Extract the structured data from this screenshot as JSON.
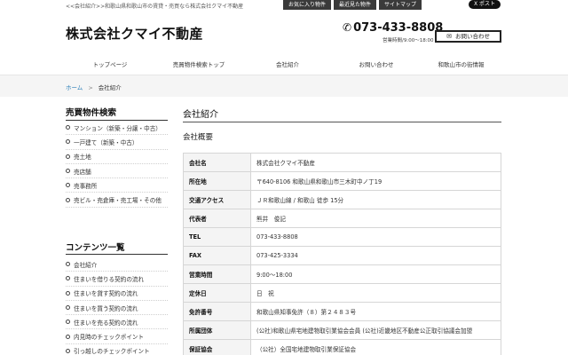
{
  "top": {
    "breadcrumb": "<<会社紹介>>和歌山県和歌山市の賃貸・売買なら株式会社クマイ不動産",
    "tabs": [
      "お気に入り物件",
      "最近見た物件",
      "サイトマップ"
    ],
    "post": "X ポスト"
  },
  "header": {
    "title": "株式会社クマイ不動産",
    "phone": "073-433-8808",
    "hours": "営業時間/9:00～18:00",
    "contact": "お問い合わせ"
  },
  "nav": [
    "トップページ",
    "売買物件検索トップ",
    "会社紹介",
    "お問い合わせ",
    "和歌山市の街情報"
  ],
  "crumb": {
    "home": "ホーム",
    "sep": ">",
    "current": "会社紹介"
  },
  "sidebar": {
    "search_title": "売買物件検索",
    "search_items": [
      "マンション（新築・分譲・中古）",
      "一戸建て（新築・中古）",
      "売土地",
      "売店舗",
      "売事務所",
      "売ビル・売倉庫・売工場・その他"
    ],
    "content_title": "コンテンツ一覧",
    "content_items": [
      "会社紹介",
      "住まいを借りる契約の流れ",
      "住まいを貸す契約の流れ",
      "住まいを買う契約の流れ",
      "住まいを売る契約の流れ",
      "内見時のチェックポイント",
      "引っ越しのチェックポイント"
    ]
  },
  "main": {
    "title": "会社紹介",
    "subtitle": "会社概要",
    "rows": [
      {
        "label": "会社名",
        "value": "株式会社クマイ不動産"
      },
      {
        "label": "所在地",
        "value": "〒640-8106 和歌山県和歌山市三木町中ノ丁19"
      },
      {
        "label": "交通アクセス",
        "value": "ＪＲ和歌山線 / 和歌山 徒歩 15分"
      },
      {
        "label": "代表者",
        "value": "熊井　俊記"
      },
      {
        "label": "TEL",
        "value": "073-433-8808"
      },
      {
        "label": "FAX",
        "value": "073-425-3334"
      },
      {
        "label": "営業時間",
        "value": "9:00～18:00"
      },
      {
        "label": "定休日",
        "value": "日　祝"
      },
      {
        "label": "免許番号",
        "value": "和歌山県知事免許（８）第２４８３号"
      },
      {
        "label": "所属団体",
        "value": "(公社)和歌山県宅地建物取引業協会会員 (公社)近畿地区不動産公正取引協議会加盟"
      },
      {
        "label": "保証協会",
        "value": "（公社）全国宅地建物取引業保証協会"
      }
    ]
  }
}
